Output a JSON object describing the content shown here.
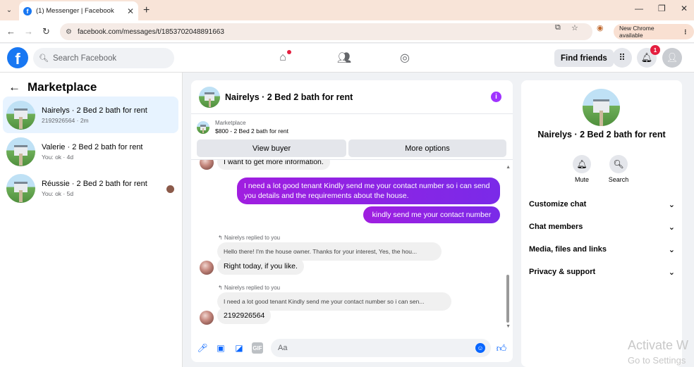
{
  "browser": {
    "tab_title": "(1) Messenger | Facebook",
    "url": "facebook.com/messages/t/1853702048891663",
    "chrome_available": "New Chrome available"
  },
  "fb_header": {
    "search_placeholder": "Search Facebook",
    "find_friends": "Find friends",
    "notification_count": "1"
  },
  "sidebar": {
    "title": "Marketplace",
    "conversations": [
      {
        "name": "Nairelys · 2 Bed 2 bath for rent",
        "sub": "2192926564 · 2m",
        "active": true
      },
      {
        "name": "Valerie · 2 Bed 2 bath for rent",
        "sub": "You: ok · 4d",
        "active": false
      },
      {
        "name": "Réussie · 2 Bed 2 bath for rent",
        "sub": "You: ok · 5d",
        "active": false
      }
    ]
  },
  "chat": {
    "title": "Nairelys · 2 Bed 2 bath for rent",
    "marketplace_label": "Marketplace",
    "listing": "$800 - 2 Bed 2 bath for rent",
    "view_buyer": "View buyer",
    "more_options": "More options",
    "messages": {
      "partial_top": "I want to get more information.",
      "out1": "I need a lot good tenant Kindly send me your contact number so i can send you details and the requirements about the house.",
      "out2": "kindly send me your contact number",
      "replied1": "Nairelys replied to you",
      "quote1": "Hello there! I'm the house owner. Thanks for your interest, Yes, the hou...",
      "in1": "Right today, if you like.",
      "replied2": "Nairelys replied to you",
      "quote2": "I need a lot good tenant Kindly send me your contact number so i can sen...",
      "in2": "2192926564"
    },
    "composer_placeholder": "Aa"
  },
  "right_panel": {
    "name": "Nairelys · 2 Bed 2 bath for rent",
    "mute": "Mute",
    "search": "Search",
    "sections": [
      "Customize chat",
      "Chat members",
      "Media, files and links",
      "Privacy & support"
    ]
  },
  "watermark": {
    "line1": "Activate W",
    "line2": "Go to Settings"
  },
  "colors": {
    "brand": "#1877f2",
    "bubble_out": "#8a25e6",
    "info": "#a033ff"
  }
}
